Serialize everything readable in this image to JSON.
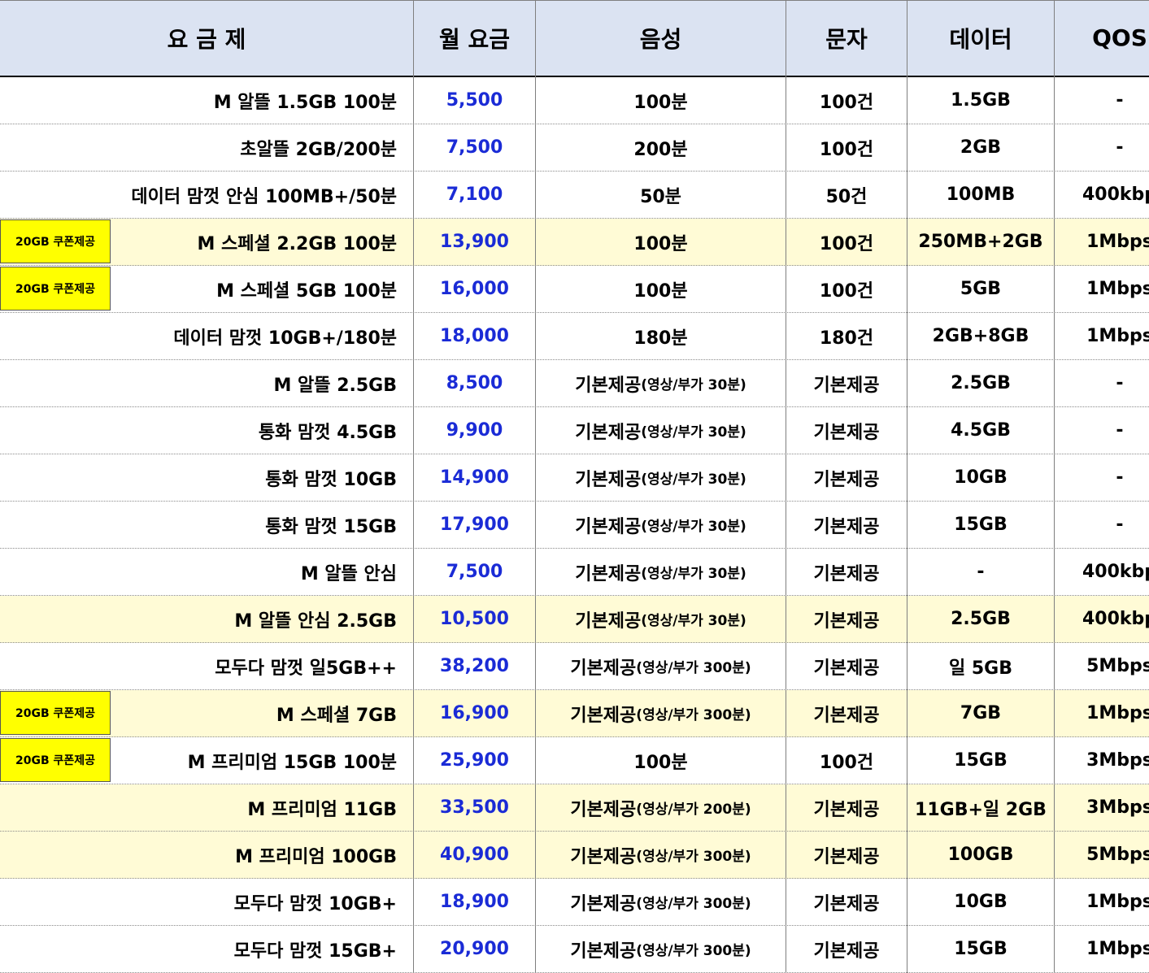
{
  "header": {
    "plan": "요 금 제",
    "fee": "월 요금",
    "voice": "음성",
    "sms": "문자",
    "data": "데이터",
    "qos": "QOS"
  },
  "colors": {
    "header_bg": "#dbe3f2",
    "highlight_row": "#fffbd6",
    "coupon_badge": "#ffff00",
    "fee_text": "#1a2bd6"
  },
  "rows": [
    {
      "name": "M 알뜰 1.5GB 100분",
      "fee": "5,500",
      "voice": "100분",
      "voice_sub": "",
      "sms": "100건",
      "data": "1.5GB",
      "qos": "-",
      "coupon": "",
      "highlight": false
    },
    {
      "name": "초알뜰 2GB/200분",
      "fee": "7,500",
      "voice": "200분",
      "voice_sub": "",
      "sms": "100건",
      "data": "2GB",
      "qos": "-",
      "coupon": "",
      "highlight": false
    },
    {
      "name": "데이터 맘껏 안심 100MB+/50분",
      "fee": "7,100",
      "voice": "50분",
      "voice_sub": "",
      "sms": "50건",
      "data": "100MB",
      "qos": "400kbp",
      "coupon": "",
      "highlight": false
    },
    {
      "name": "M 스페셜 2.2GB 100분",
      "fee": "13,900",
      "voice": "100분",
      "voice_sub": "",
      "sms": "100건",
      "data": "250MB+2GB",
      "qos": "1Mbps",
      "coupon": "20GB 쿠폰제공",
      "highlight": true
    },
    {
      "name": "M 스페셜 5GB 100분",
      "fee": "16,000",
      "voice": "100분",
      "voice_sub": "",
      "sms": "100건",
      "data": "5GB",
      "qos": "1Mbps",
      "coupon": "20GB 쿠폰제공",
      "highlight": false
    },
    {
      "name": "데이터 맘껏 10GB+/180분",
      "fee": "18,000",
      "voice": "180분",
      "voice_sub": "",
      "sms": "180건",
      "data": "2GB+8GB",
      "qos": "1Mbps",
      "coupon": "",
      "highlight": false
    },
    {
      "name": "M 알뜰 2.5GB",
      "fee": "8,500",
      "voice": "기본제공",
      "voice_sub": "(영상/부가 30분)",
      "sms": "기본제공",
      "data": "2.5GB",
      "qos": "-",
      "coupon": "",
      "highlight": false
    },
    {
      "name": "통화 맘껏 4.5GB",
      "fee": "9,900",
      "voice": "기본제공",
      "voice_sub": "(영상/부가 30분)",
      "sms": "기본제공",
      "data": "4.5GB",
      "qos": "-",
      "coupon": "",
      "highlight": false
    },
    {
      "name": "통화 맘껏 10GB",
      "fee": "14,900",
      "voice": "기본제공",
      "voice_sub": "(영상/부가 30분)",
      "sms": "기본제공",
      "data": "10GB",
      "qos": "-",
      "coupon": "",
      "highlight": false
    },
    {
      "name": "통화 맘껏 15GB",
      "fee": "17,900",
      "voice": "기본제공",
      "voice_sub": "(영상/부가 30분)",
      "sms": "기본제공",
      "data": "15GB",
      "qos": "-",
      "coupon": "",
      "highlight": false
    },
    {
      "name": "M 알뜰 안심",
      "fee": "7,500",
      "voice": "기본제공",
      "voice_sub": "(영상/부가 30분)",
      "sms": "기본제공",
      "data": "-",
      "qos": "400kbp",
      "coupon": "",
      "highlight": false
    },
    {
      "name": "M 알뜰 안심 2.5GB",
      "fee": "10,500",
      "voice": "기본제공",
      "voice_sub": "(영상/부가 30분)",
      "sms": "기본제공",
      "data": "2.5GB",
      "qos": "400kbp",
      "coupon": "",
      "highlight": true
    },
    {
      "name": "모두다 맘껏 일5GB++",
      "fee": "38,200",
      "voice": "기본제공",
      "voice_sub": "(영상/부가 300분)",
      "sms": "기본제공",
      "data": "일 5GB",
      "qos": "5Mbps",
      "coupon": "",
      "highlight": false
    },
    {
      "name": "M 스페셜 7GB",
      "fee": "16,900",
      "voice": "기본제공",
      "voice_sub": "(영상/부가 300분)",
      "sms": "기본제공",
      "data": "7GB",
      "qos": "1Mbps",
      "coupon": "20GB 쿠폰제공",
      "highlight": true
    },
    {
      "name": "M 프리미엄 15GB 100분",
      "fee": "25,900",
      "voice": "100분",
      "voice_sub": "",
      "sms": "100건",
      "data": "15GB",
      "qos": "3Mbps",
      "coupon": "20GB 쿠폰제공",
      "highlight": false
    },
    {
      "name": "M 프리미엄 11GB",
      "fee": "33,500",
      "voice": "기본제공",
      "voice_sub": "(영상/부가 200분)",
      "sms": "기본제공",
      "data": "11GB+일 2GB",
      "qos": "3Mbps",
      "coupon": "",
      "highlight": true
    },
    {
      "name": "M 프리미엄 100GB",
      "fee": "40,900",
      "voice": "기본제공",
      "voice_sub": "(영상/부가 300분)",
      "sms": "기본제공",
      "data": "100GB",
      "qos": "5Mbps",
      "coupon": "",
      "highlight": true
    },
    {
      "name": "모두다 맘껏 10GB+",
      "fee": "18,900",
      "voice": "기본제공",
      "voice_sub": "(영상/부가 300분)",
      "sms": "기본제공",
      "data": "10GB",
      "qos": "1Mbps",
      "coupon": "",
      "highlight": false
    },
    {
      "name": "모두다 맘껏 15GB+",
      "fee": "20,900",
      "voice": "기본제공",
      "voice_sub": "(영상/부가 300분)",
      "sms": "기본제공",
      "data": "15GB",
      "qos": "1Mbps",
      "coupon": "",
      "highlight": false
    }
  ]
}
